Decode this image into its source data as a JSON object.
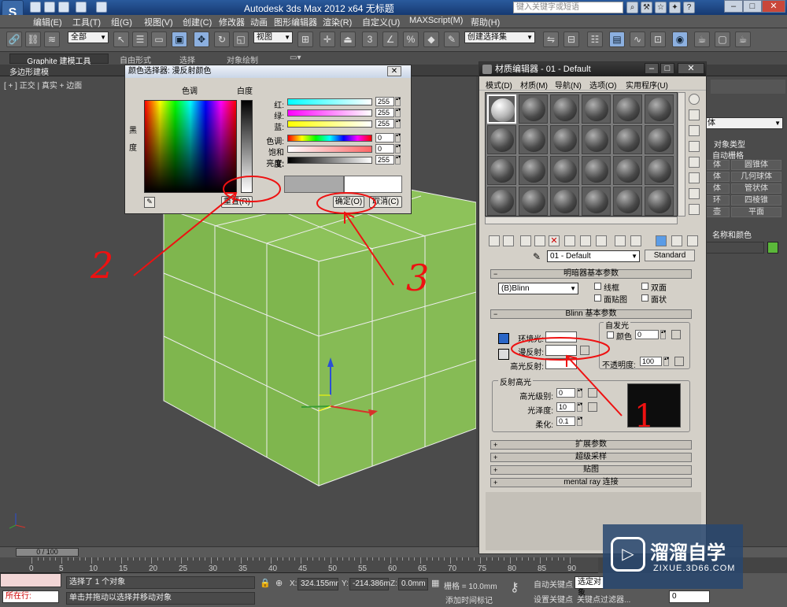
{
  "app": {
    "title": "Autodesk 3ds Max  2012 x64    无标题",
    "search_placeholder": "键入关键字或短语"
  },
  "menu": [
    "编辑(E)",
    "工具(T)",
    "组(G)",
    "视图(V)",
    "创建(C)",
    "修改器",
    "动画",
    "图形编辑器",
    "渲染(R)",
    "自定义(U)",
    "MAXScript(M)",
    "帮助(H)"
  ],
  "toolbar": {
    "filter": "全部",
    "refcoord": "视图",
    "selset": "创建选择集"
  },
  "ribbon": {
    "tabs": [
      "Graphite 建模工具",
      "自由形式",
      "选择",
      "对象绘制"
    ],
    "sub": "多边形建模"
  },
  "viewport": {
    "label": "[ + ] 正交 | 真实 + 边面"
  },
  "color_picker": {
    "title": "颜色选择器: 漫反射颜色",
    "hue_label": "色调",
    "white_label": "白度",
    "black_label": "黑",
    "degree_label": "度",
    "rows": [
      {
        "label": "红:",
        "value": "255"
      },
      {
        "label": "绿:",
        "value": "255"
      },
      {
        "label": "蓝:",
        "value": "255"
      },
      {
        "label": "色调:",
        "value": "0"
      },
      {
        "label": "饱和度:",
        "value": "0"
      },
      {
        "label": "亮度:",
        "value": "255"
      }
    ],
    "reset": "重置(R)",
    "ok": "确定(O)",
    "cancel": "取消(C)"
  },
  "material_editor": {
    "title": "材质编辑器 - 01 - Default",
    "menu": [
      "模式(D)",
      "材质(M)",
      "导航(N)",
      "选项(O)",
      "实用程序(U)"
    ],
    "material_name": "01 - Default",
    "material_type": "Standard",
    "shader_rollout": "明暗器基本参数",
    "shader": "(B)Blinn",
    "shader_opts": [
      "线框",
      "双面",
      "面贴图",
      "面状"
    ],
    "blinn_rollout": "Blinn 基本参数",
    "self_illum": "自发光",
    "color_label": "颜色",
    "self_illum_value": "0",
    "ambient": "环境光:",
    "diffuse": "漫反射:",
    "specular": "高光反射:",
    "opacity_label": "不透明度:",
    "opacity": "100",
    "highlight_group": "反射高光",
    "spec_level_label": "高光级别:",
    "spec_level": "0",
    "gloss_label": "光泽度:",
    "gloss": "10",
    "soften_label": "柔化:",
    "soften": "0.1",
    "rollouts": [
      "扩展参数",
      "超级采样",
      "贴图",
      "mental ray 连接"
    ]
  },
  "cmd_panel": {
    "dropdown": "体",
    "object_type": "对象类型",
    "autogrid": "自动栅格",
    "buttons": [
      "体",
      "圆锥体",
      "体",
      "几何球体",
      "体",
      "管状体",
      "环",
      "四棱锥",
      "壶",
      "平面"
    ],
    "name_color": "名称和颜色"
  },
  "timeline": {
    "slider": "0 / 100",
    "ticks": [
      "0",
      "5",
      "10",
      "15",
      "20",
      "25",
      "30",
      "35",
      "40",
      "45",
      "50",
      "55",
      "60",
      "65",
      "70",
      "75",
      "80",
      "85",
      "90"
    ]
  },
  "status": {
    "selected": "选择了 1 个对象",
    "hint": "单击并拖动以选择并移动对象",
    "script_state": "所在行:",
    "x_label": "X:",
    "x": "324.155mr",
    "y_label": "Y:",
    "y": "-214.386m",
    "z_label": "Z:",
    "z": "0.0mm",
    "grid": "栅格 = 10.0mm",
    "autokey": "自动关键点",
    "selected_obj": "选定对象",
    "setkey": "设置关键点",
    "keyfilter": "关键点过滤器...",
    "addtime": "添加时间标记",
    "frame": "0"
  },
  "watermark": {
    "brand": "溜溜自学",
    "url": "ZIXUE.3D66.COM"
  },
  "annotations": {
    "n2": "2",
    "n3": "3",
    "n1": "1"
  }
}
